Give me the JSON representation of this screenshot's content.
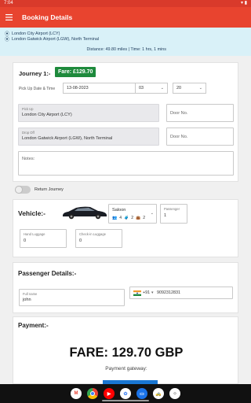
{
  "status_bar": {
    "time": "7:04",
    "icons": "▾ ▮"
  },
  "app_bar": {
    "title": "Booking Details",
    "menu_icon": "hamburger-icon"
  },
  "route": {
    "pickup": "London City Airport (LCY)",
    "dropoff": "London Gatwick Airport (LGW), North Terminal",
    "distance_text": "Distance: 49.80 miles | Time: 1 hrs, 1 mins"
  },
  "journey": {
    "title": "Journey 1:-",
    "fare_badge": "Fare: £129.70",
    "pickup_label": "Pick Up Date & Time",
    "date": "13-08-2023",
    "hour": "03",
    "minute": "20",
    "pickup_field_caption": "Pick Up",
    "pickup_field_value": "London City Airport (LCY)",
    "door_placeholder": "Door No.",
    "dropoff_field_caption": "Drop Off",
    "dropoff_field_value": "London Gatwick Airport (LGW), North Terminal",
    "notes_placeholder": "Notes:",
    "return_label": "Return Journey"
  },
  "vehicle": {
    "title": "Vehicle:-",
    "name": "Saloon",
    "passengers_count": "4",
    "luggage_count": "2",
    "hand_count": "2",
    "passenger_caption": "Passenger",
    "passenger_value": "1",
    "hand_luggage_caption": "Hand Luggage",
    "hand_luggage_value": "0",
    "checkin_caption": "Check-in Luggage",
    "checkin_value": "0"
  },
  "passenger": {
    "title": "Passenger Details:-",
    "name_caption": "Full name",
    "name_value": "john",
    "phone_code": "+91",
    "phone_value": "9092312831"
  },
  "payment": {
    "title": "Payment:-",
    "fare_text": "FARE: 129.70 GBP",
    "gateway_text": "Payment gateway:"
  },
  "colors": {
    "brand": "#e8442f",
    "badge": "#1e8a3c",
    "route_bg": "#d9f1f8"
  }
}
